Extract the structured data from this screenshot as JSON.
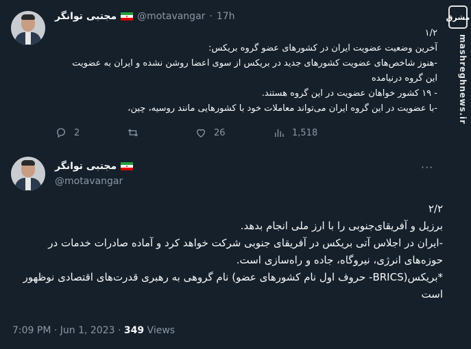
{
  "tweet1": {
    "display_name": "مجتبی توانگر",
    "handle": "@motavangar",
    "separator": "·",
    "time": "17h",
    "more": "···",
    "lines": [
      "۱/۲",
      "آخرین وضعیت عضویت ایران در کشورهای عضو گروه بریکس:",
      "-هنوز شاخص‌های عضویت کشورهای جدید در بریکس از سوی اعضا روشن نشده و ایران به عضویت",
      "این گروه درنیامده",
      "- ۱۹ کشور خواهان عضویت در این گروه هستند.",
      "-با عضویت در این گروه ایران می‌تواند معاملات خود با کشورهایی مانند روسیه، چین،"
    ],
    "replies": "2",
    "retweets": "",
    "likes": "26",
    "views": "1,518"
  },
  "tweet2": {
    "display_name": "مجتبی توانگر",
    "handle": "@motavangar",
    "more": "···",
    "lines": [
      "۲/۲",
      "برزیل و آفریقای‌جنوبی را با ارز ملی انجام بدهد.",
      "-ایران در اجلاس آتی بریکس در آفریقای جنوبی شرکت خواهد کرد و آماده صادرات خدمات در",
      "حوزه‌های انرژی، نیروگاه، جاده و راه‌سازی است.",
      "*بریکس(BRICS- حروف اول نام کشورهای عضو) نام گروهی به رهبری قدرت‌های اقتصادی نوظهور",
      "است"
    ],
    "timestamp": "7:09 PM · Jun 1, 2023 · ",
    "views_count": "349",
    "views_label": " Views"
  },
  "watermark": {
    "logo": "مشرق",
    "site": "mashreghnews.ir"
  },
  "colors": {
    "background": "#15202b",
    "text": "#f7f9f9",
    "muted": "#8b98a5"
  },
  "icons": [
    "reply-icon",
    "retweet-icon",
    "like-icon",
    "views-icon",
    "more-icon",
    "iran-flag-icon"
  ]
}
